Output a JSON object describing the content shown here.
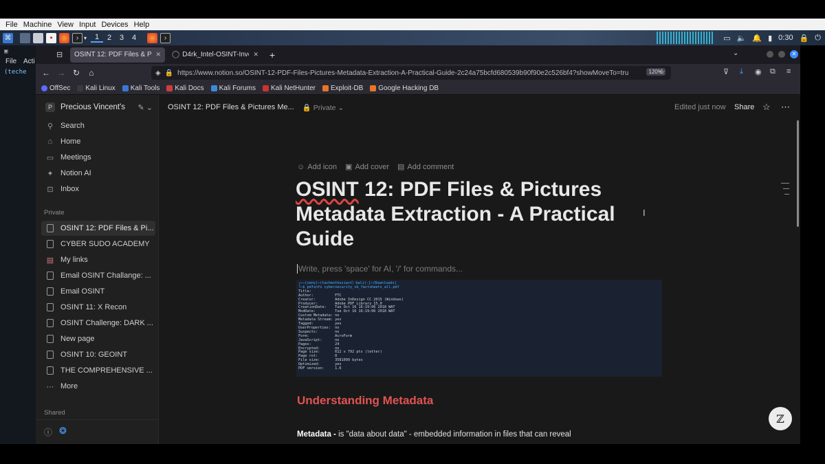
{
  "vm_menu": [
    "File",
    "Machine",
    "View",
    "Input",
    "Devices",
    "Help"
  ],
  "panel": {
    "workspaces": [
      "1",
      "2",
      "3",
      "4"
    ],
    "clock": "0:30"
  },
  "terminal_left": {
    "menu_file": "File",
    "menu_actions": "Acti",
    "prompt": "(teche"
  },
  "tabs": [
    {
      "label": "OSINT 12: PDF Files & Pictur",
      "active": true
    },
    {
      "label": "D4rk_Intel-OSINT-Invest",
      "active": false
    }
  ],
  "url": "https://www.notion.so/OSINT-12-PDF-Files-Pictures-Metadata-Extraction-A-Practical-Guide-2c24a75bcfd680539b90f90e2c526bf4?showMoveTo=true&",
  "zoom": "120%",
  "bookmarks": [
    "OffSec",
    "Kali Linux",
    "Kali Tools",
    "Kali Docs",
    "Kali Forums",
    "Kali NetHunter",
    "Exploit-DB",
    "Google Hacking DB"
  ],
  "sidebar": {
    "workspace_initial": "P",
    "workspace": "Precious Vincent's",
    "nav": [
      "Search",
      "Home",
      "Meetings",
      "Notion AI",
      "Inbox"
    ],
    "private_label": "Private",
    "pages": [
      "OSINT 12: PDF Files & Pi...",
      "CYBER SUDO ACADEMY",
      "My links",
      "Email OSINT Challange: ...",
      "Email OSINT",
      "OSINT 11: X Recon",
      "OSINT Challenge: DARK ...",
      "New page",
      "OSINT 10: GEOINT",
      "THE COMPREHENSIVE ..."
    ],
    "more": "More",
    "shared_label": "Shared"
  },
  "topbar": {
    "breadcrumb": "OSINT 12: PDF Files & Pictures Me...",
    "privacy": "Private",
    "edited": "Edited just now",
    "share": "Share"
  },
  "page": {
    "add_icon": "Add icon",
    "add_cover": "Add cover",
    "add_comment": "Add comment",
    "title_first": "OSINT",
    "title_rest": " 12: PDF Files & Pictures Metadata Extraction - A Practical Guide",
    "placeholder": "Write, press 'space' for AI, '/' for commands...",
    "heading": "Understanding Metadata",
    "para_bold": "Metadata -",
    "para_text": " is \"data about data\" - embedded information in files that can reveal"
  },
  "terminal_shot": {
    "prompt": "┌──(venv)─(techenthusiast〉kali)-[~/Downloads]",
    "command": "└─$ pdfinfo cybersecurity_sb_factsheets_all.pdf",
    "lines": [
      "Title:",
      "Author:          FTC",
      "Creator:         Adobe InDesign CC 2015 (Windows)",
      "Producer:        Adobe PDF Library 15.0",
      "CreationDate:    Tue Oct 16 16:19:06 2018 WAT",
      "ModDate:         Tue Oct 16 16:19:06 2018 WAT",
      "Custom Metadata: no",
      "Metadata Stream: yes",
      "Tagged:          yes",
      "UserProperties:  no",
      "Suspects:        no",
      "Form:            AcroForm",
      "JavaScript:      no",
      "Pages:           24",
      "Encrypted:       no",
      "Page size:       612 x 792 pts (letter)",
      "Page rot:        0",
      "File size:       3581099 bytes",
      "Optimized:       yes",
      "PDF version:     1.6"
    ]
  }
}
